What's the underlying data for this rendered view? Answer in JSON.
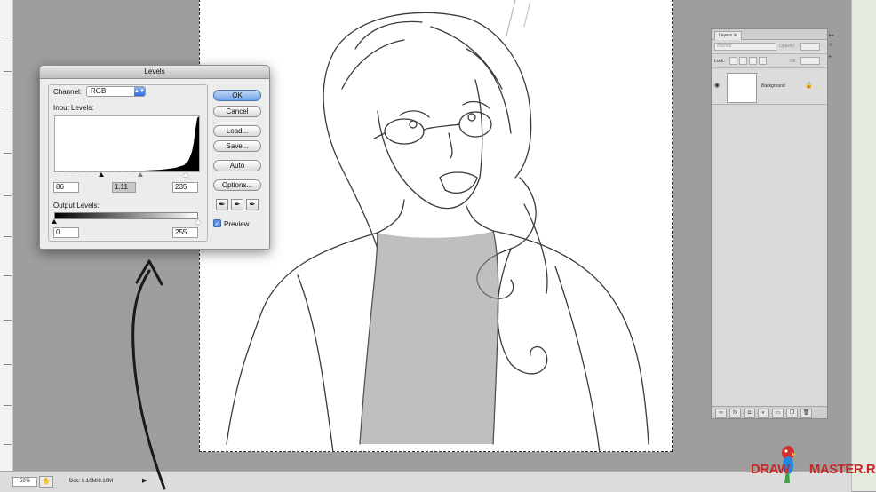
{
  "statusbar": {
    "zoom": "50%",
    "doc": "Doc: 8.10M/8.10M",
    "arrow": "▶"
  },
  "levels": {
    "title": "Levels",
    "channel_label": "Channel:",
    "channel_value": "RGB",
    "input_levels_label": "Input Levels:",
    "input_black": "86",
    "input_gamma": "1.11",
    "input_white": "235",
    "output_levels_label": "Output Levels:",
    "output_black": "0",
    "output_white": "255",
    "buttons": {
      "ok": "OK",
      "cancel": "Cancel",
      "load": "Load...",
      "save": "Save...",
      "auto": "Auto",
      "options": "Options..."
    },
    "preview_label": "Preview",
    "preview_checked": true
  },
  "layers": {
    "tab": "Layers ✕",
    "blend_mode": "Normal",
    "opacity_label": "Opacity:",
    "lock_label": "Lock:",
    "fill_label": "Fill:",
    "layer_name": "Background"
  },
  "watermark": {
    "draw": "DRAW",
    "master": "MASTER.RU"
  },
  "icons": {
    "eye": "eye-icon",
    "lock": "lock-icon",
    "eyedropper": "eyedropper-icon",
    "hand": "hand-icon"
  },
  "colors": {
    "accent_blue": "#2d6be0",
    "watermark_red": "#c62828"
  }
}
